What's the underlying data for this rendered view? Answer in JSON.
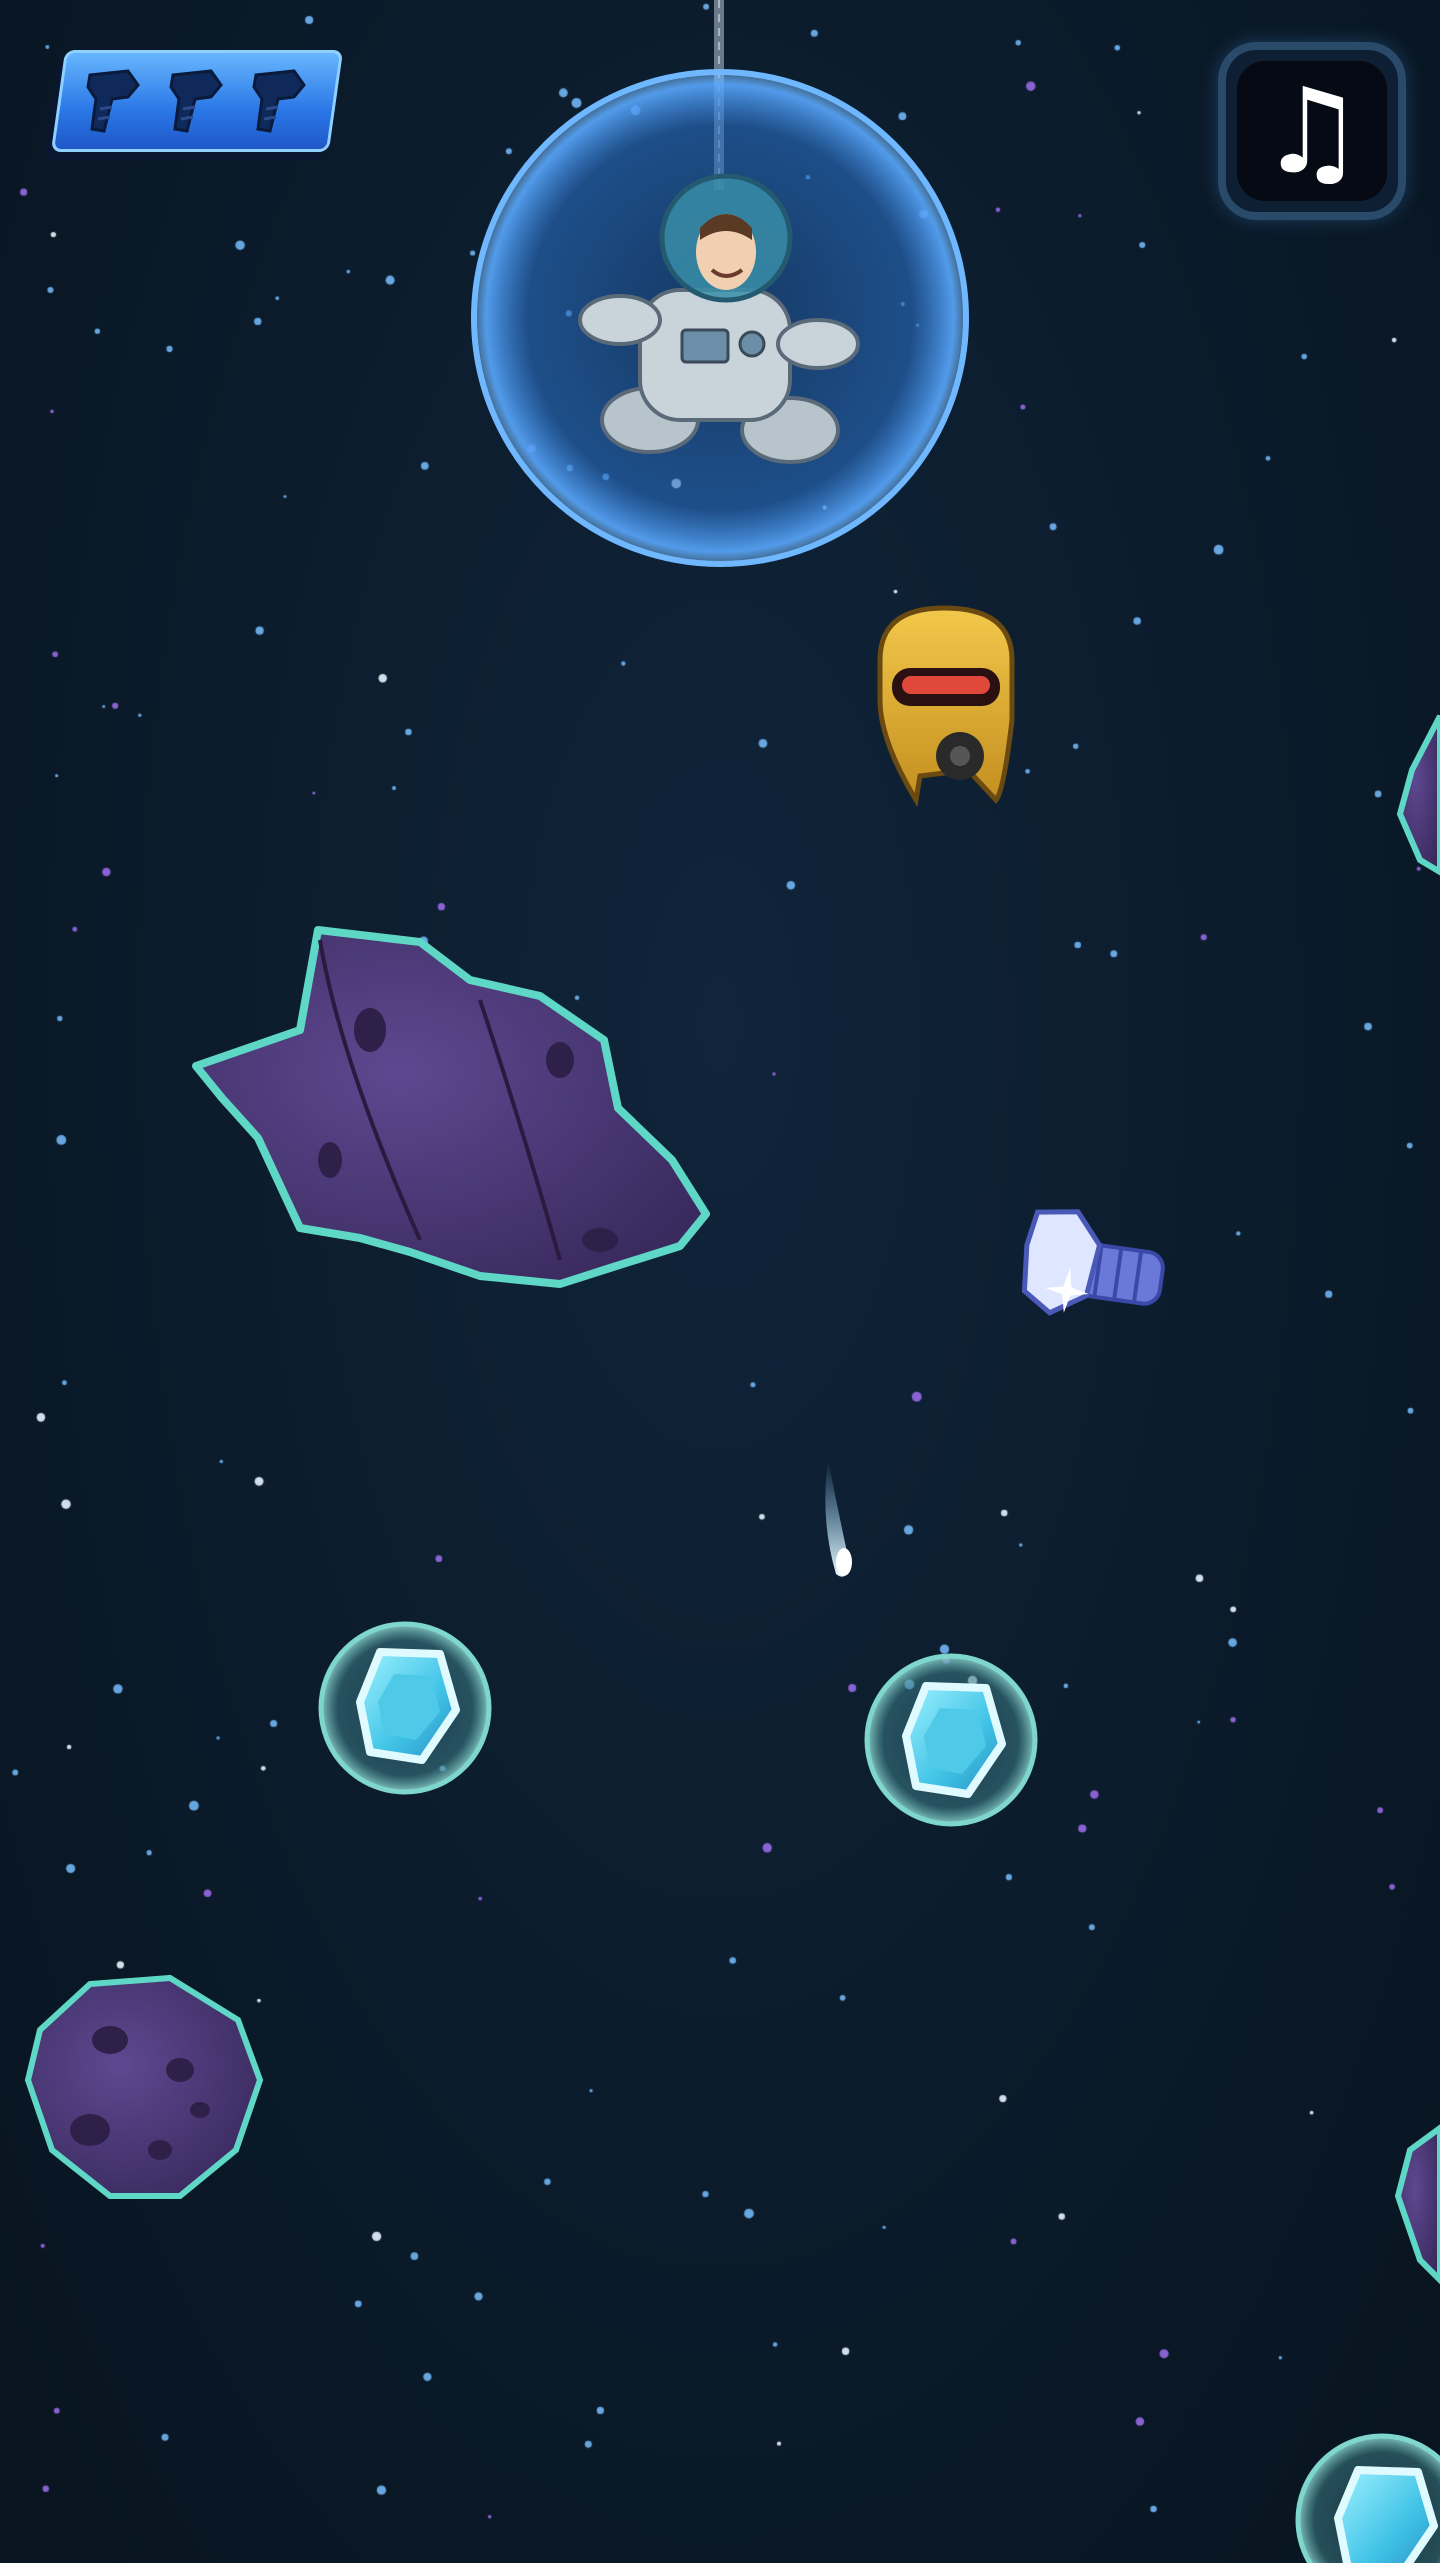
{
  "hud": {
    "lives": {
      "count": 3,
      "icon": "bolt-icon",
      "color": "#2f86f0"
    },
    "music_button": {
      "icon": "music-note-icon",
      "glyph": "♫"
    }
  },
  "colors": {
    "background": "#0b1b2b",
    "bubble": "#3f8fe6",
    "asteroid": "#4a3a74",
    "asteroid_edge": "#5fd7c6",
    "gem": "#5fd8f0",
    "robot": "#e3b43a"
  },
  "scene": {
    "player": "astronaut-in-bubble",
    "enemy": "yellow-robot-drone",
    "collectibles": [
      "bolt-pickup",
      "gem-bubble",
      "gem-bubble",
      "gem-bubble"
    ],
    "obstacles": [
      "large-asteroid",
      "small-asteroid",
      "edge-asteroid",
      "edge-asteroid"
    ],
    "effects": [
      "comet"
    ]
  }
}
